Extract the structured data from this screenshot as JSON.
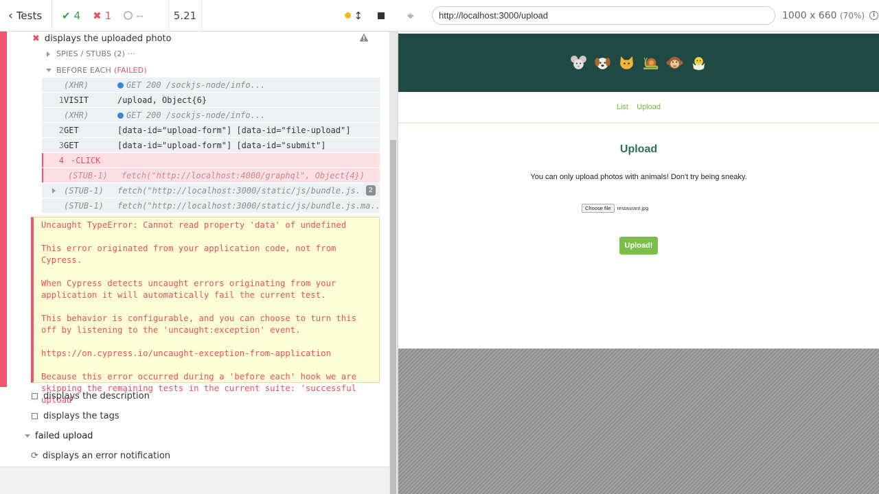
{
  "reporter": {
    "header": {
      "tests_label": "Tests",
      "passed": "4",
      "failed": "1",
      "pending": "--",
      "duration": "5.21"
    },
    "current_test": {
      "title": "displays the uploaded photo",
      "spies_label": "SPIES / STUBS",
      "spies_count": "(2)",
      "spies_more": "···",
      "hook_label": "BEFORE EACH",
      "hook_status": "(FAILED)"
    },
    "commands": [
      {
        "num": "",
        "name": "(XHR)",
        "msg": "GET 200 /sockjs-node/info..."
      },
      {
        "num": "1",
        "name": "VISIT",
        "msg": "/upload, Object{6}"
      },
      {
        "num": "",
        "name": "(XHR)",
        "msg": "GET 200 /sockjs-node/info..."
      },
      {
        "num": "2",
        "name": "GET",
        "msg": "[data-id=\"upload-form\"] [data-id=\"file-upload\"]"
      },
      {
        "num": "3",
        "name": "GET",
        "msg": "[data-id=\"upload-form\"] [data-id=\"submit\"]"
      },
      {
        "num": "4",
        "name": "-CLICK",
        "msg": ""
      },
      {
        "num": "",
        "name": "(STUB-1)",
        "msg": "fetch(\"http://localhost:4000/graphql\", Object{4})"
      },
      {
        "num": "",
        "name": "(STUB-1)",
        "msg": "fetch(\"http://localhost:3000/static/js/bundle.js...",
        "badge": "2"
      },
      {
        "num": "",
        "name": "(STUB-1)",
        "msg": "fetch(\"http://localhost:3000/static/js/bundle.js.ma..."
      }
    ],
    "error": {
      "p1": "Uncaught TypeError: Cannot read property 'data' of undefined",
      "p2": "This error originated from your application code, not from Cypress.",
      "p3": "When Cypress detects uncaught errors originating from your application it will automatically fail the current test.",
      "p4": "This behavior is configurable, and you can choose to turn this off by listening to the 'uncaught:exception' event.",
      "p5": "https://on.cypress.io/uncaught-exception-from-application",
      "p6": "Because this error occurred during a 'before each' hook we are skipping the remaining tests in the current suite: 'successful upload'"
    },
    "other_tests": {
      "description": "displays the description",
      "tags": "displays the tags",
      "suite": "failed upload",
      "notification": "displays an error notification"
    }
  },
  "aut": {
    "url": "http://localhost:3000/upload",
    "viewport": "1000 x 660",
    "scale": "(70%)",
    "app": {
      "nav_list": "List",
      "nav_upload": "Upload",
      "title": "Upload",
      "description": "You can only upload photos with animals! Don't try being sneaky.",
      "choose_file": "Choose file",
      "file_name": "restaurant.jpg",
      "upload_button": "Upload!"
    }
  },
  "colors": {
    "pass": "#3b9b4d",
    "fail": "#e94f5f",
    "banner": "#1f4a43",
    "accent_green": "#6cbb3c"
  }
}
